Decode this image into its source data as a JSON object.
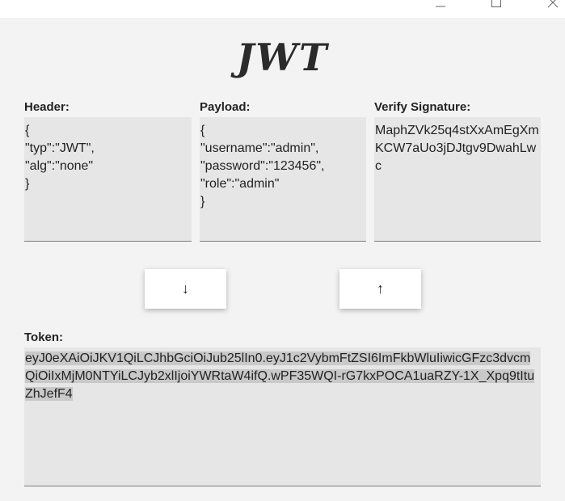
{
  "window": {
    "controls": {
      "minimize_icon": "minimize-icon",
      "maximize_icon": "maximize-icon",
      "close_icon": "close-icon"
    }
  },
  "logo": {
    "text": "JWT"
  },
  "header": {
    "label": "Header:",
    "value": "{\n\"typ\":\"JWT\",\n\"alg\":\"none\"\n}"
  },
  "payload": {
    "label": "Payload:",
    "value": "{\n\"username\":\"admin\",\n\"password\":\"123456\",\n\"role\":\"admin\"\n}"
  },
  "signature": {
    "label": "Verify Signature:",
    "value": "MaphZVk25q4stXxAmEgXmKCW7aUo3jDJtgv9DwahLwc"
  },
  "buttons": {
    "decode_label": "↓",
    "encode_label": "↑"
  },
  "token": {
    "label": "Token:",
    "value": "eyJ0eXAiOiJKV1QiLCJhbGciOiJub25lIn0.eyJ1c2VybmFtZSI6ImFkbWluIiwicGFzc3dvcmQiOiIxMjM0NTYiLCJyb2xlIjoiYWRtaW4ifQ.wPF35WQI-rG7kxPOCA1uaRZY-1X_Xpq9tItuZhJefF4"
  }
}
